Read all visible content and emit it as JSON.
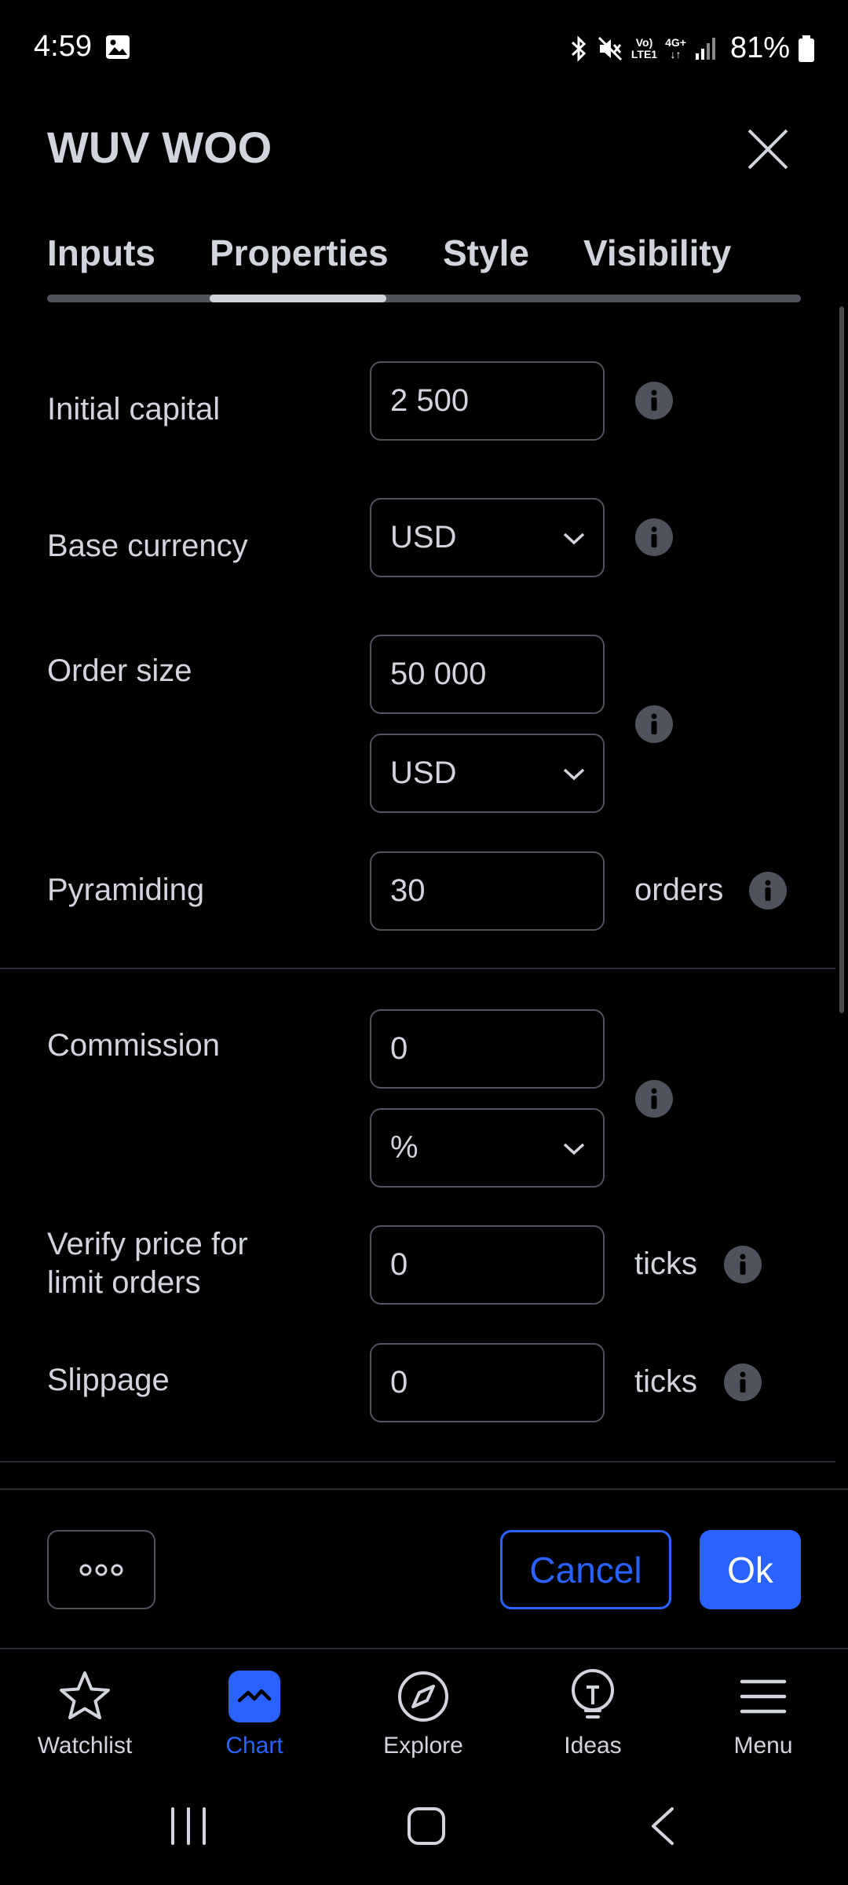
{
  "status_bar": {
    "time": "4:59",
    "network_top": "Vo)",
    "network_bottom": "LTE1",
    "network_type": "4G+",
    "battery": "81%"
  },
  "dialog": {
    "title": "WUV WOO"
  },
  "tabs": [
    {
      "label": "Inputs",
      "active": false
    },
    {
      "label": "Properties",
      "active": true
    },
    {
      "label": "Style",
      "active": false
    },
    {
      "label": "Visibility",
      "active": false
    }
  ],
  "form": {
    "initial_capital": {
      "label": "Initial capital",
      "value": "2 500"
    },
    "base_currency": {
      "label": "Base currency",
      "value": "USD"
    },
    "order_size": {
      "label": "Order size",
      "value": "50 000",
      "unit_value": "USD"
    },
    "pyramiding": {
      "label": "Pyramiding",
      "value": "30",
      "unit": "orders"
    },
    "commission": {
      "label": "Commission",
      "value": "0",
      "unit_value": "%"
    },
    "verify_price": {
      "label_line1": "Verify price for",
      "label_line2": "limit orders",
      "value": "0",
      "unit": "ticks"
    },
    "slippage": {
      "label": "Slippage",
      "value": "0",
      "unit": "ticks"
    }
  },
  "buttons": {
    "cancel": "Cancel",
    "ok": "Ok"
  },
  "bottom_nav": [
    {
      "label": "Watchlist",
      "icon": "star-icon",
      "active": false
    },
    {
      "label": "Chart",
      "icon": "chart-icon",
      "active": true
    },
    {
      "label": "Explore",
      "icon": "compass-icon",
      "active": false
    },
    {
      "label": "Ideas",
      "icon": "lightbulb-icon",
      "active": false
    },
    {
      "label": "Menu",
      "icon": "hamburger-icon",
      "active": false
    }
  ],
  "colors": {
    "accent": "#2962ff",
    "text": "#d1d4dc",
    "border": "#50535e",
    "background": "#000000"
  }
}
